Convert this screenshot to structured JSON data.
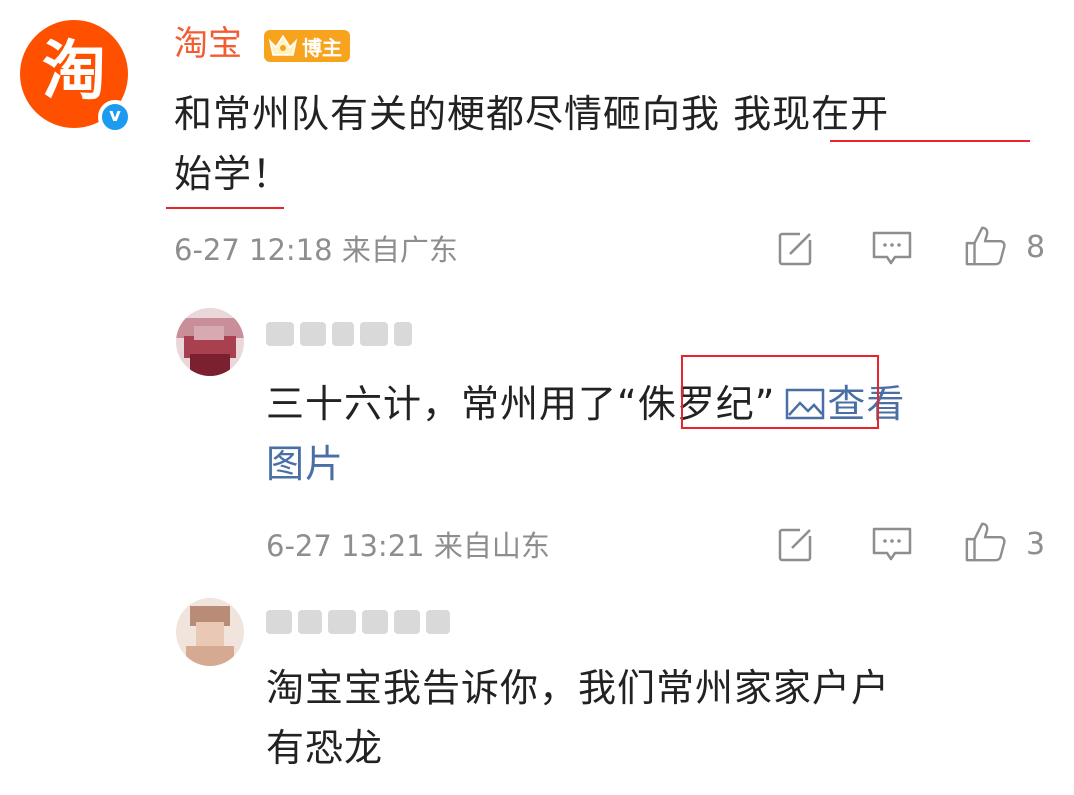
{
  "main_comment": {
    "avatar_char": "淘",
    "verified_char": "v",
    "username": "淘宝",
    "badge_label": "博主",
    "text_part1": "和常州队有关的梗都尽情砸向我 ",
    "text_underlined_a": "我现在开",
    "text_underlined_b": "始学！",
    "timestamp": "6-27 12:18",
    "location": "来自广东",
    "like_count": "8"
  },
  "replies": [
    {
      "text_before": "三十六计，常州用了",
      "text_highlight": "“侏罗纪”",
      "link_icon": "image-icon",
      "link_text_a": "查看",
      "link_text_b": "图片",
      "timestamp": "6-27 13:21",
      "location": "来自山东",
      "like_count": "3"
    },
    {
      "text_line1": "淘宝宝我告诉你，我们常州家家户户",
      "text_line2": "有恐龙"
    }
  ],
  "colors": {
    "accent": "#ff5000",
    "username": "#f25c30",
    "underline": "#e8252d",
    "link": "#4a6fa5",
    "meta": "#8e8e8e"
  }
}
